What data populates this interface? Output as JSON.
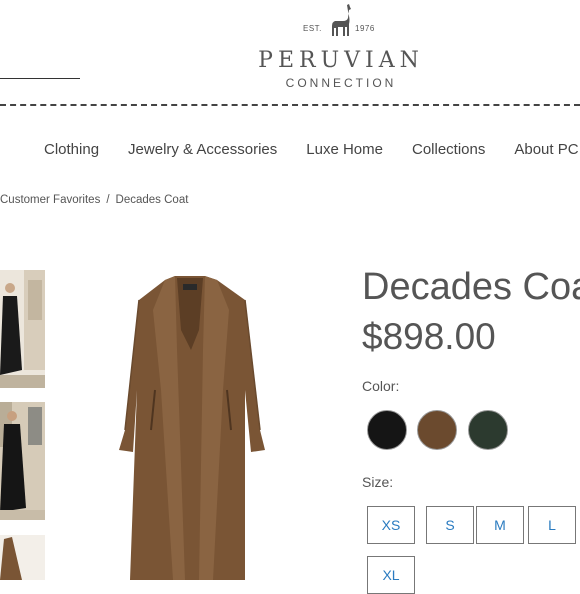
{
  "header": {
    "logo_est": "EST.",
    "logo_year": "1976",
    "brand_main": "PERUVIAN",
    "brand_sub": "CONNECTION"
  },
  "nav": {
    "items": [
      "Clothing",
      "Jewelry & Accessories",
      "Luxe Home",
      "Collections",
      "About PC"
    ]
  },
  "breadcrumb": {
    "items": [
      "Customer Favorites",
      "Decades Coat"
    ],
    "separator": "/"
  },
  "product": {
    "title": "Decades Coat",
    "price": "$898.00",
    "color_label": "Color:",
    "colors": [
      {
        "name": "black",
        "hex": "#1a1a1a"
      },
      {
        "name": "brown",
        "hex": "#6b4a2e"
      },
      {
        "name": "green",
        "hex": "#2f3a30"
      }
    ],
    "selected_color": "brown",
    "size_label": "Size:",
    "sizes": [
      "XS",
      "S",
      "M",
      "L",
      "XL"
    ]
  },
  "colors": {
    "size_text": "#2a7bc0",
    "text": "#4a4a4a",
    "coat": "#7a5535"
  }
}
